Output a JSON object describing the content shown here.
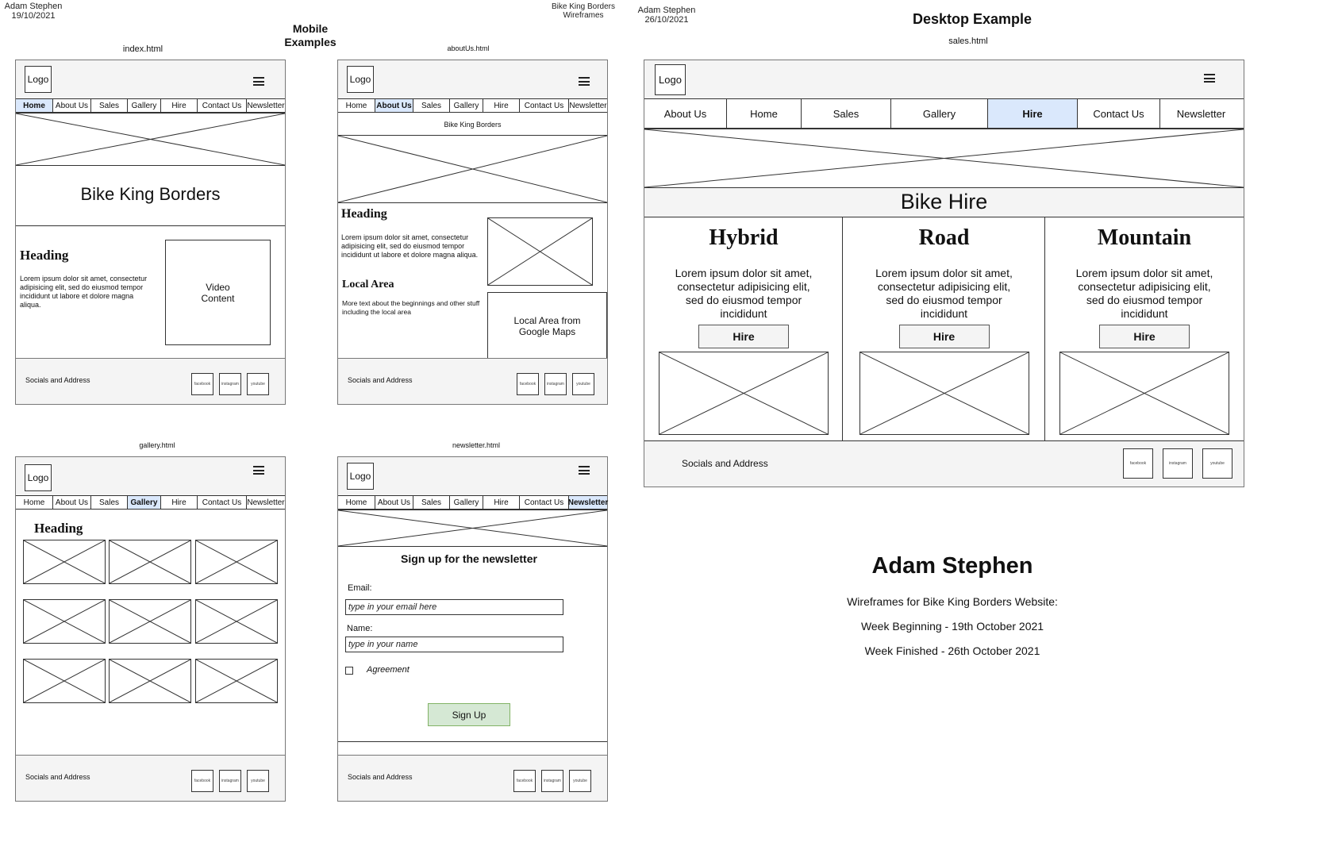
{
  "meta_left": {
    "author": "Adam Stephen",
    "date": "19/10/2021"
  },
  "meta_mobile_title": "Mobile Examples",
  "meta_center": {
    "line1": "Bike King Borders",
    "line2": "Wireframes"
  },
  "meta_right": {
    "author": "Adam Stephen",
    "date": "26/10/2021"
  },
  "desktop_title": "Desktop Example",
  "common": {
    "logo": "Logo",
    "socials": "Socials and Address",
    "facebook": "facebook",
    "instagram": "instagram",
    "youtube": "youtube",
    "nav_mobile": [
      "Home",
      "About Us",
      "Sales",
      "Gallery",
      "Hire",
      "Contact Us",
      "Newsletter"
    ]
  },
  "index": {
    "filename": "index.html",
    "title": "Bike King Borders",
    "heading": "Heading",
    "text": "Lorem ipsum dolor sit amet, consectetur adipisicing elit, sed do eiusmod tempor incididunt ut labore et dolore magna aliqua.",
    "video": "Video Content",
    "active": "Home"
  },
  "about": {
    "filename": "aboutUs.html",
    "subtitle": "Bike King Borders",
    "heading": "Heading",
    "text": "Lorem ipsum dolor sit amet, consectetur adipisicing elit, sed do eiusmod tempor incididunt ut labore et dolore magna aliqua.",
    "local_heading": "Local Area",
    "local_text": "More text about the beginnings and other stuff including the local area",
    "map": "Local Area from Google Maps",
    "active": "About Us"
  },
  "gallery": {
    "filename": "gallery.html",
    "heading": "Heading",
    "active": "Gallery"
  },
  "newsletter": {
    "filename": "newsletter.html",
    "title": "Sign up for the newsletter",
    "email_label": "Email:",
    "email_placeholder": "type in your email here",
    "name_label": "Name:",
    "name_placeholder": "type in your name",
    "agreement": "Agreement",
    "signup": "Sign Up",
    "active": "Newsletter"
  },
  "sales": {
    "filename": "sales.html",
    "nav": [
      "About Us",
      "Home",
      "Sales",
      "Gallery",
      "Hire",
      "Contact Us",
      "Newsletter"
    ],
    "active": "Hire",
    "title": "Bike Hire",
    "columns": [
      {
        "heading": "Hybrid",
        "text": "Lorem ipsum dolor sit amet, consectetur adipisicing elit, sed do eiusmod tempor incididunt",
        "button": "Hire"
      },
      {
        "heading": "Road",
        "text": "Lorem ipsum dolor sit amet, consectetur adipisicing elit, sed do eiusmod tempor incididunt",
        "button": "Hire"
      },
      {
        "heading": "Mountain",
        "text": "Lorem ipsum dolor sit amet, consectetur adipisicing elit, sed do eiusmod tempor incididunt",
        "button": "Hire"
      }
    ]
  },
  "summary": {
    "name": "Adam Stephen",
    "line1": "Wireframes for Bike King Borders Website:",
    "line2": "Week Beginning - 19th October 2021",
    "line3": "Week Finished - 26th October 2021"
  },
  "colors": {
    "header_bg": "#f4f4f4",
    "active_nav": "#dae8fc",
    "signup_btn": "#d5e8d4"
  }
}
